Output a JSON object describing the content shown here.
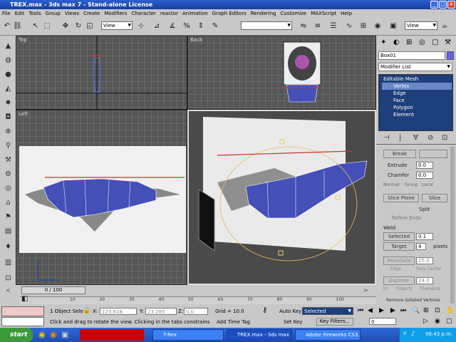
{
  "window": {
    "title": "TREX.max - 3ds max 7 - Stand-alone License"
  },
  "menu": [
    "File",
    "Edit",
    "Tools",
    "Group",
    "Views",
    "Create",
    "Modifiers",
    "Character",
    "reactor",
    "Animation",
    "Graph Editors",
    "Rendering",
    "Customize",
    "MAXScript",
    "Help"
  ],
  "toolbar": {
    "view_dropdown": "View",
    "view_dropdown2": "View"
  },
  "viewports": {
    "top": "Top",
    "back": "Back",
    "left": "Left"
  },
  "command_panel": {
    "object_name": "Box01",
    "modifier_list": "Modifier List",
    "stack": {
      "root": "Editable Mesh",
      "items": [
        "Vertex",
        "Edge",
        "Face",
        "Polygon",
        "Element"
      ]
    },
    "buttons": {
      "break": "Break",
      "extrude": "Extrude",
      "chamfer": "Chamfer",
      "slice_plane": "Slice Plane",
      "slice": "Slice",
      "split": "Split",
      "refine_ends": "Refine Ends",
      "weld": "Weld",
      "selected": "Selected",
      "target": "Target",
      "tessellate": "Tessellate",
      "explode": "Explode",
      "remove_isolated": "Remove Isolated Vertices"
    },
    "values": {
      "extrude": "0.0",
      "chamfer": "0.0",
      "weld_selected": "0.1",
      "weld_target": "4",
      "tessellate": "25.0",
      "explode": "24.0"
    },
    "labels": {
      "normal": "Normal:",
      "group": "Group",
      "local": "Local",
      "pixels": "pixels",
      "edge": "Edge",
      "face_center": "Face Center",
      "to": "to:",
      "objects": "Objects",
      "elements": "Elements"
    }
  },
  "timeline": {
    "counter": "0 / 100",
    "ticks": [
      "10",
      "20",
      "30",
      "40",
      "50",
      "60",
      "70",
      "80",
      "90",
      "100"
    ]
  },
  "status": {
    "selection": "1 Object Sele",
    "x": "123.618",
    "y": "23.285",
    "z": "0.0",
    "grid": "Grid = 10.0",
    "autokey": "Auto Key",
    "selected_dd": "Selected",
    "setkey": "Set Key",
    "key_filters": "Key Filters...",
    "prompt": "Click and drag to rotate the view.  Clicking in the tabs constrains the rotation",
    "add_time_tag": "Add Time Tag",
    "frame": "0"
  },
  "taskbar": {
    "start": "start",
    "tasks": [
      "T-Rex",
      "TREX.max - 3ds max ...",
      "Adobe Fireworks CS3..."
    ],
    "clock": "06:43 p.m."
  },
  "colors": {
    "title": "#2b5fd0",
    "mesh": "#4450b8",
    "selection": "#1f3f7a"
  }
}
